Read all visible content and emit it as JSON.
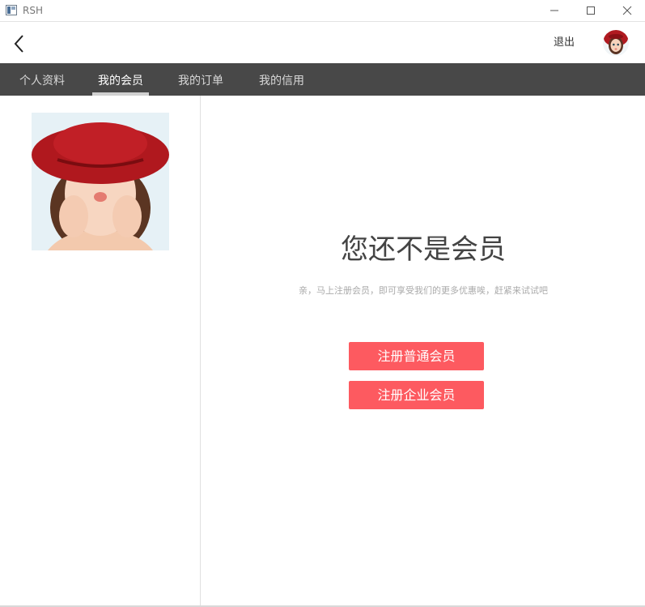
{
  "window": {
    "title": "RSH",
    "buttons": [
      "minimize",
      "maximize",
      "close"
    ]
  },
  "header": {
    "back_icon": "chevron-left-icon",
    "logout_label": "退出",
    "avatar": "user-avatar"
  },
  "tabs": [
    {
      "label": "个人资料",
      "active": false
    },
    {
      "label": "我的会员",
      "active": true
    },
    {
      "label": "我的订单",
      "active": false
    },
    {
      "label": "我的信用",
      "active": false
    }
  ],
  "main": {
    "title": "您还不是会员",
    "subtitle": "亲，马上注册会员，即可享受我们的更多优惠唉，赶紧来试试吧",
    "register_normal_label": "注册普通会员",
    "register_company_label": "注册企业会员"
  },
  "colors": {
    "tab_bar": "#484848",
    "primary_button": "#fd5a60",
    "tab_active_indicator": "#d0d0d0"
  }
}
